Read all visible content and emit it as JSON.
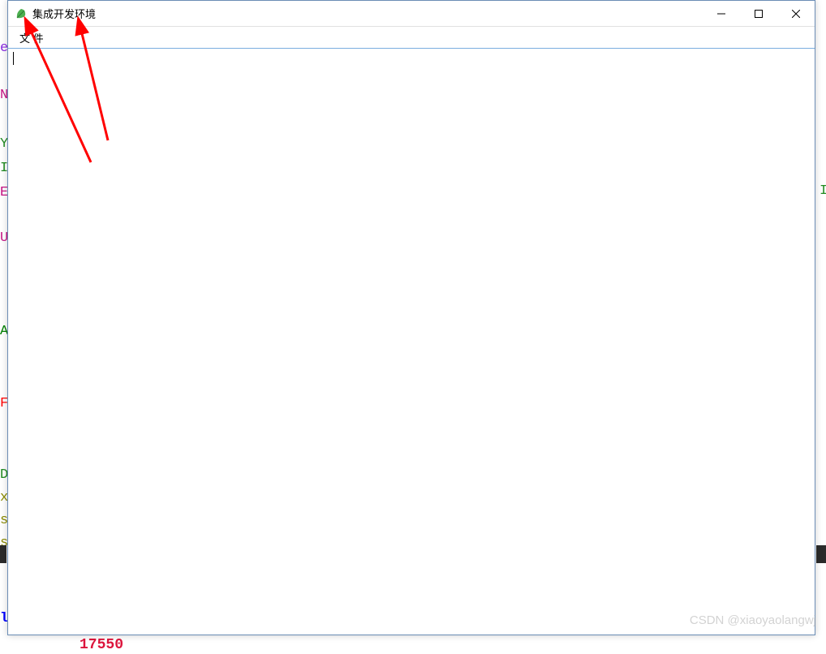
{
  "window": {
    "title": "集成开发环境",
    "minimize_label": "−",
    "maximize_label": "□",
    "close_label": "✕"
  },
  "menu": {
    "file": "文 件"
  },
  "editor": {
    "content": ""
  },
  "background_chars": {
    "e": "e",
    "n": "N",
    "y": "Y",
    "i1": "I",
    "e2": "E",
    "i2": "I",
    "u": "U",
    "a": "A",
    "f": "F",
    "d": "D",
    "x": "x",
    "s1": "s",
    "s2": "s",
    "l": "l",
    "num": "17550"
  },
  "watermark": "CSDN @xiaoyaolangwj"
}
